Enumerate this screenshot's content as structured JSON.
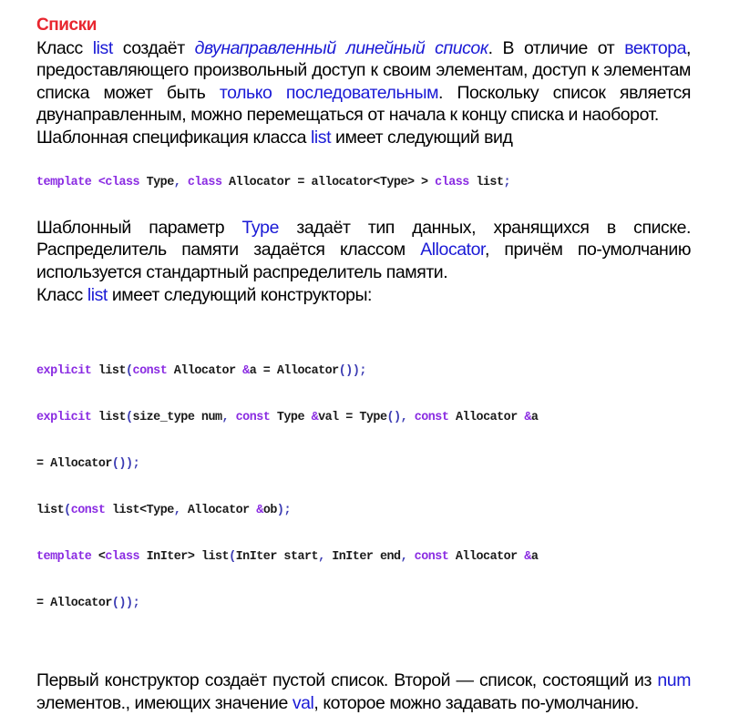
{
  "document": {
    "title": "Списки",
    "intro": {
      "p1_a": "Класс ",
      "p1_list": "list",
      "p1_b": " создаёт ",
      "p1_italic": "двунаправленный линейный список",
      "p1_c": ". В отличие от ",
      "p1_vector": "вектора",
      "p1_d": ", предоставляющего произвольный доступ к своим элементам, доступ к элементам списка может быть ",
      "p1_only": "только последовательным",
      "p1_e": ". Поскольку список является двунаправленным, можно перемещаться от начала к концу списка и наоборот.",
      "p2_a": "Шаблонная спецификация класса ",
      "p2_list": "list",
      "p2_b": " имеет следующий вид"
    },
    "template_decl": {
      "t1": "template",
      "t2": " <",
      "t3": "class",
      "t4": " Type",
      "t5": ", ",
      "t6": "class",
      "t7": " Allocator = allocator<Type> > ",
      "t8": "class",
      "t9": " list",
      "t10": ";"
    },
    "params": {
      "p3_a": "Шаблонный параметр ",
      "p3_type": "Type",
      "p3_b": " задаёт тип данных, хранящихся в списке. Распределитель памяти задаётся классом ",
      "p3_alloc": "Allocator",
      "p3_c": ", причём по-умолчанию используется стандартный распределитель памяти.",
      "p4_a": "Класс ",
      "p4_list": "list",
      "p4_b": " имеет следующий конструкторы:"
    },
    "constructors": [
      "explicit list(const Allocator &a = Allocator());",
      "explicit list(size_type num, const Type &val = Type(), const Allocator &a",
      "= Allocator());",
      "list(const list<Type, Allocator &ob);",
      "template <class InIter> list(InIter start, InIter end, const Allocator &a",
      "= Allocator());"
    ],
    "outro": {
      "p5_a": "Первый конструктор создаёт пустой список. Второй — список, состоящий из ",
      "p5_num": "num",
      "p5_b": " элементов., имеющих значение ",
      "p5_val": "val",
      "p5_c": ", которое можно задавать по-умолчанию."
    }
  },
  "colors": {
    "title": "#e8262f",
    "highlight": "#1a1ad6",
    "code_keyword": "#8a2be2",
    "code_punct": "#3b3bb3",
    "text": "#000000"
  }
}
